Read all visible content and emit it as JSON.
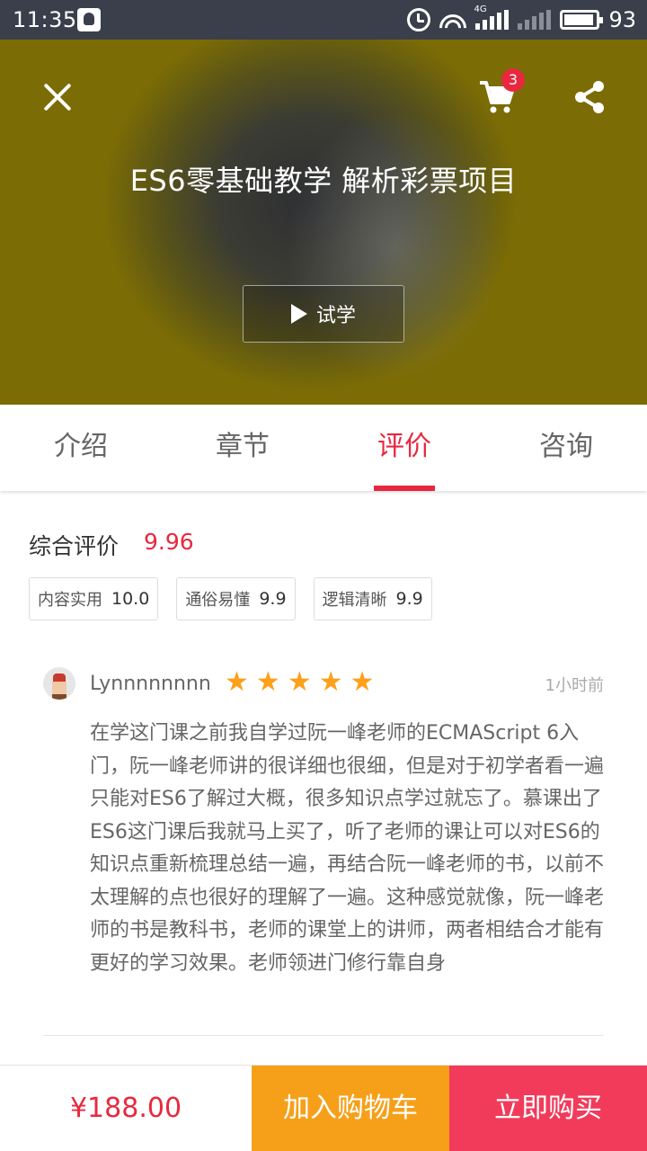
{
  "status_bar": {
    "time": "11:35",
    "network": "4G",
    "battery_level": "93",
    "battery_fraction": 0.93
  },
  "header": {
    "cart_count": "3",
    "course_title": "ES6零基础教学 解析彩票项目",
    "trial_label": "试学"
  },
  "tabs": [
    {
      "label": "介绍",
      "active": false
    },
    {
      "label": "章节",
      "active": false
    },
    {
      "label": "评价",
      "active": true
    },
    {
      "label": "咨询",
      "active": false
    }
  ],
  "summary": {
    "label": "综合评价",
    "score": "9.96",
    "metrics": [
      {
        "label": "内容实用",
        "value": "10.0"
      },
      {
        "label": "通俗易懂",
        "value": "9.9"
      },
      {
        "label": "逻辑清晰",
        "value": "9.9"
      }
    ]
  },
  "review": {
    "username": "Lynnnnnnnn",
    "rating": 5,
    "time": "1小时前",
    "text": "在学这门课之前我自学过阮一峰老师的ECMAScript 6入门，阮一峰老师讲的很详细也很细，但是对于初学者看一遍只能对ES6了解过大概，很多知识点学过就忘了。慕课出了ES6这门课后我就马上买了，听了老师的课让可以对ES6的知识点重新梳理总结一遍，再结合阮一峰老师的书，以前不太理解的点也很好的理解了一遍。这种感觉就像，阮一峰老师的书是教科书，老师的课堂上的讲师，两者相结合才能有更好的学习效果。老师领进门修行靠自身"
  },
  "bottom_bar": {
    "price": "¥188.00",
    "add_to_cart": "加入购物车",
    "buy_now": "立即购买"
  },
  "colors": {
    "accent": "#e8283f",
    "add_to_cart_bg": "#f6a01a",
    "buy_now_bg": "#f23b5a",
    "star": "#ff9f1a",
    "status_bar_bg": "#3a3f4b"
  }
}
